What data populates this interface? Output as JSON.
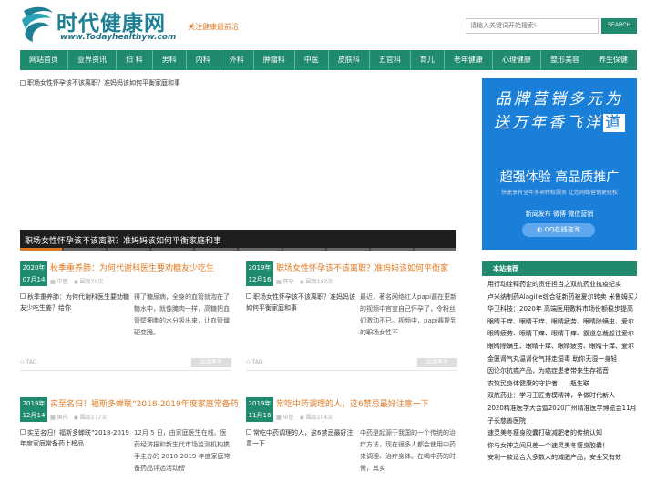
{
  "header": {
    "logo_title": "时代健康网",
    "logo_url": "www.Todayhealthyw.com",
    "slogan": "关注健康最前沿",
    "search_placeholder": "请输入关键词开始搜索!",
    "search_button": "SEARCH"
  },
  "nav": [
    "网站首页",
    "业界资讯",
    "妇 科",
    "男科",
    "内科",
    "外科",
    "肿瘤科",
    "中医",
    "皮肤科",
    "五官科",
    "育儿",
    "老年健康",
    "心理健康",
    "整形美容",
    "养生保健"
  ],
  "carousel": {
    "image_alt": "职场女性怀孕该不该离职？准妈妈该如何平衡家庭和事",
    "caption": "职场女性怀孕该不该离职？准妈妈该如何平衡家庭和事",
    "slides": 10,
    "active": 0
  },
  "articles": [
    {
      "year": "2020年",
      "day": "07月14日",
      "title": "秋季重养肺：为何代谢科医生要劝糖友少吃生",
      "category": "中医",
      "views": "围观70次",
      "thumb_alt": "秋季重养肺：为何代谢科医生要劝糖友少吃生姜？给你",
      "excerpt": "得了糖尿病，全身的血管就泡在了糖水中，就像腌肉一样，高糖把血管壁细胞的水分吸出来，让血管僵硬变脆。",
      "tag": "TAG:",
      "more": "阅读更多"
    },
    {
      "year": "2019年",
      "day": "12月16日",
      "title": "职场女性怀孕该不该离职？准妈妈该如何平衡家",
      "category": "怀孕",
      "views": "围观183次",
      "thumb_alt": "职场女性怀孕该不该离职？准妈妈该如何平衡家庭和事",
      "excerpt": "最近，著名网络红人papi酱在更新的视频中官宣自己怀孕了，令粉丝们激动不已。视频中，papi酱提到的职场女性不",
      "tag": "TAG:",
      "more": "阅读更多"
    },
    {
      "year": "2019年",
      "day": "12月14日",
      "title": "实至名归！福斯多蝉联“2018-2019年度家庭常备药",
      "category": "国内",
      "views": "围观177次",
      "thumb_alt": "实至名归！福斯多蝉联“2018-2019年度家庭常备药上榜品",
      "excerpt": "12月 5 日，由家庭医生在线、医药经济报和新生代市场监测机构携手主办的 2018-2019 年度家庭常备药品评选活动榜",
      "tag": "",
      "more": ""
    },
    {
      "year": "2019年",
      "day": "11月16日",
      "title": "常吃中药调理的人，这6禁忌最好注意一下",
      "category": "中医",
      "views": "围观104次",
      "thumb_alt": "常吃中药调理的人，这6禁忌最好注意一下",
      "excerpt": "中药是起源于我国的一个传统的治疗方法，现在很多人都会使用中药来调理、治疗身体。在喝中药的时候，其实",
      "tag": "",
      "more": ""
    }
  ],
  "ad": {
    "calligraphy": [
      "品牌营销多元为",
      "送万年香飞洋",
      "道"
    ],
    "main": "超强体验 高品质推广",
    "sub": "快速享有全年多项特权服务 让您网络营销更轻松",
    "links": "新闻发布 微博 微信营销",
    "qq": "QQ在线咨询"
  },
  "sidebar": {
    "heading": "本站推荐",
    "items": [
      "用行动诠释药企的责任担当之双航药业抗疫纪实",
      "卢米纳制药Alagille综合征新药被夏尔转卖 米鲁姆买入",
      "华卫科技：2020年 高端医用敷料市场份额稳步提高",
      "眼睛干痒、眼睛干痒、眼睛疲劳、眼睛除螨虫、爱尔",
      "眼睛疲劳、眼睛干痒、眼睛干痒、霸道总裁般往爱尔",
      "眼睛除螨虫、眼睛干痒、眼睛疲劳、眼睛干痒、爱尔",
      "金匮肾气丸温肾化气排走湿毒 助你无湿一身轻",
      "因论尔抗癌产品，为癌症患者带来生存福音",
      "农牧民身体健康的守护者——瓶生联",
      "双航药业：学习王匠劳模精神，争做时代新人",
      "2020精准医学大会暨2020广州精准医学博览会11月将在",
      "子长慈善医院",
      "速灵美冬瘦身胶囊打破减肥者的传统认知",
      "你与女神之间只差一个速灵美冬瘦身胶囊！",
      "安利一款适合大多数人的减肥产品，安全又有效"
    ]
  }
}
